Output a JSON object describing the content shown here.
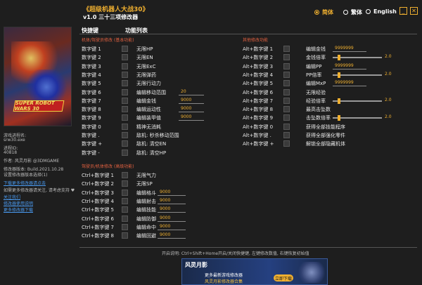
{
  "header": {
    "title": "《超级机器人大战30》",
    "version": "v1.0 三十三项修改器",
    "languages": [
      "简体",
      "繁体",
      "English"
    ],
    "minimize": "_",
    "close": "✕"
  },
  "cover": {
    "logo_text": "SUPER ROBOT WARS 30"
  },
  "info": {
    "process_label": "游戏进程名:",
    "process_value": "srw30.exe",
    "pid_label": "进程ID:",
    "pid_value": "40818",
    "author": "作者: 风灵月影 @3DMGAME",
    "build": "修改器版本: Build.2021.10.28",
    "options": "设置修改器版本选择(1)",
    "links": [
      "下载更多修改器请点击",
      "使用修改器前需要注意事项",
      "关注我们",
      "修改器使用说明",
      "更多修改器下载"
    ],
    "extra": "如需更多修改器请关注, 请考虑支持 ♥"
  },
  "columns": {
    "hotkey": "快捷键",
    "functions": "功能列表"
  },
  "sections": {
    "left_main": "机体/驾驶员修改 (基本功能)",
    "left_extra": "驾驶员/机体修改 (高级功能)",
    "right_main": "其他修改功能"
  },
  "left_rows": [
    {
      "key": "数字键 1",
      "fn": "无限HP"
    },
    {
      "key": "数字键 2",
      "fn": "无限EN"
    },
    {
      "key": "数字键 3",
      "fn": "无限ExC"
    },
    {
      "key": "数字键 4",
      "fn": "无限弹药"
    },
    {
      "key": "数字键 5",
      "fn": "无限行动力"
    },
    {
      "key": "数字键 6",
      "fn": "编辑移动范围",
      "value": "20"
    },
    {
      "key": "数字键 7",
      "fn": "编辑金钱",
      "value": "9000"
    },
    {
      "key": "数字键 8",
      "fn": "编辑运动性",
      "value": "9000"
    },
    {
      "key": "数字键 9",
      "fn": "编辑装甲值",
      "value": "9000"
    },
    {
      "key": "数字键 0",
      "fn": "精神无消耗"
    },
    {
      "key": "数字键 .",
      "fn": "敌机: 秒杀移动范围"
    },
    {
      "key": "数字键 +",
      "fn": "敌机: 清空EN"
    },
    {
      "key": "数字键 -",
      "fn": "敌机: 清空HP"
    }
  ],
  "left_extra_rows": [
    {
      "key": "Ctrl+数字键 1",
      "fn": "无限气力"
    },
    {
      "key": "Ctrl+数字键 2",
      "fn": "无限SP"
    },
    {
      "key": "Ctrl+数字键 3",
      "fn": "编辑格斗",
      "value": "9000"
    },
    {
      "key": "Ctrl+数字键 4",
      "fn": "编辑射击",
      "value": "9000"
    },
    {
      "key": "Ctrl+数字键 5",
      "fn": "编辑技能",
      "value": "9000"
    },
    {
      "key": "Ctrl+数字键 6",
      "fn": "编辑防御",
      "value": "9000"
    },
    {
      "key": "Ctrl+数字键 7",
      "fn": "编辑命中",
      "value": "9000"
    },
    {
      "key": "Ctrl+数字键 8",
      "fn": "编辑回避",
      "value": "9000"
    }
  ],
  "right_rows": [
    {
      "key": "Alt+数字键 1",
      "fn": "编辑金钱",
      "value": "9999999"
    },
    {
      "key": "Alt+数字键 2",
      "fn": "金钱倍率",
      "slider": 2.0,
      "slider_label": "2.0"
    },
    {
      "key": "Alt+数字键 3",
      "fn": "编辑PP",
      "value": "9999999"
    },
    {
      "key": "Alt+数字键 4",
      "fn": "PP倍率",
      "slider": 2.0,
      "slider_label": "2.0"
    },
    {
      "key": "Alt+数字键 5",
      "fn": "编辑MxP",
      "value": "9999999"
    },
    {
      "key": "Alt+数字键 6",
      "fn": "无限经验"
    },
    {
      "key": "Alt+数字键 7",
      "fn": "经验倍率",
      "slider": 2.0,
      "slider_label": "2.0"
    },
    {
      "key": "Alt+数字键 8",
      "fn": "最高击坠数"
    },
    {
      "key": "Alt+数字键 9",
      "fn": "击坠数倍率",
      "slider": 2.0,
      "slider_label": "2.0"
    },
    {
      "key": "Alt+数字键 0",
      "fn": "获得全部技能程序"
    },
    {
      "key": "Alt+数字键 .",
      "fn": "获得全部强化零件"
    },
    {
      "key": "Alt+数字键 +",
      "fn": "解锁全部隐藏机体"
    }
  ],
  "footer": {
    "text": "开启说明: Ctrl+Shift+Home开启/关闭快捷键, 左键修改数值, 右键恢复初始值",
    "ad": {
      "brand": "风灵月影",
      "line1": "更多最新游戏修改器",
      "line2": "风灵月影修改器合集",
      "button": "立即下载"
    }
  }
}
